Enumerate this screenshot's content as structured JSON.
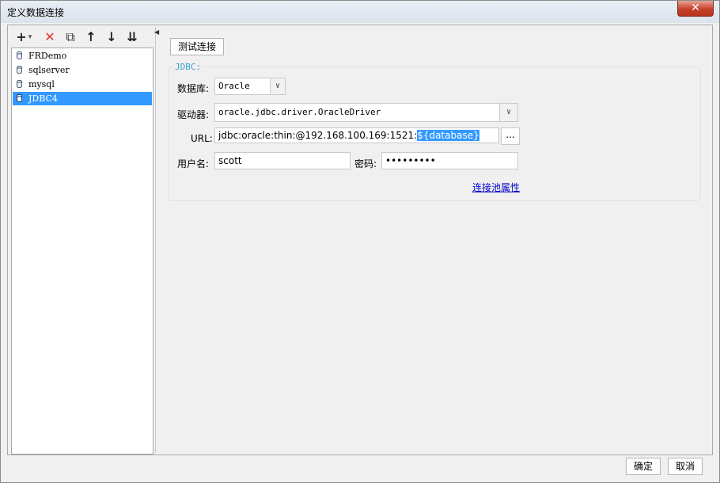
{
  "window": {
    "title": "定义数据连接",
    "close_glyph": "✕"
  },
  "toolbar": {
    "add_glyph": "+",
    "add_menu_glyph": "▾",
    "delete_glyph": "✕",
    "copy_glyph": "⧉",
    "move_up_glyph": "↑",
    "move_down_glyph": "↓",
    "sort_glyph": "⇊"
  },
  "connections": [
    {
      "label": "FRDemo",
      "selected": false
    },
    {
      "label": "sqlserver",
      "selected": false
    },
    {
      "label": "mysql",
      "selected": false
    },
    {
      "label": "JDBC4",
      "selected": true
    }
  ],
  "panel": {
    "test_button": "测试连接",
    "group_title": "JDBC:",
    "database_label": "数据库:",
    "database_value": "Oracle",
    "driver_label": "驱动器:",
    "driver_value": "oracle.jdbc.driver.OracleDriver",
    "url_label": "URL:",
    "url_prefix": "jdbc:oracle:thin:@192.168.100.169:1521:",
    "url_selected": "${database}",
    "url_browse": "...",
    "user_label": "用户名:",
    "user_value": "scott",
    "password_label": "密码:",
    "password_value": "•••••••••",
    "pool_link": "连接池属性"
  },
  "footer": {
    "ok": "确定",
    "cancel": "取消"
  },
  "colors": {
    "selection": "#3399ff",
    "legend": "#3aa0c4",
    "link": "#0000cc"
  }
}
